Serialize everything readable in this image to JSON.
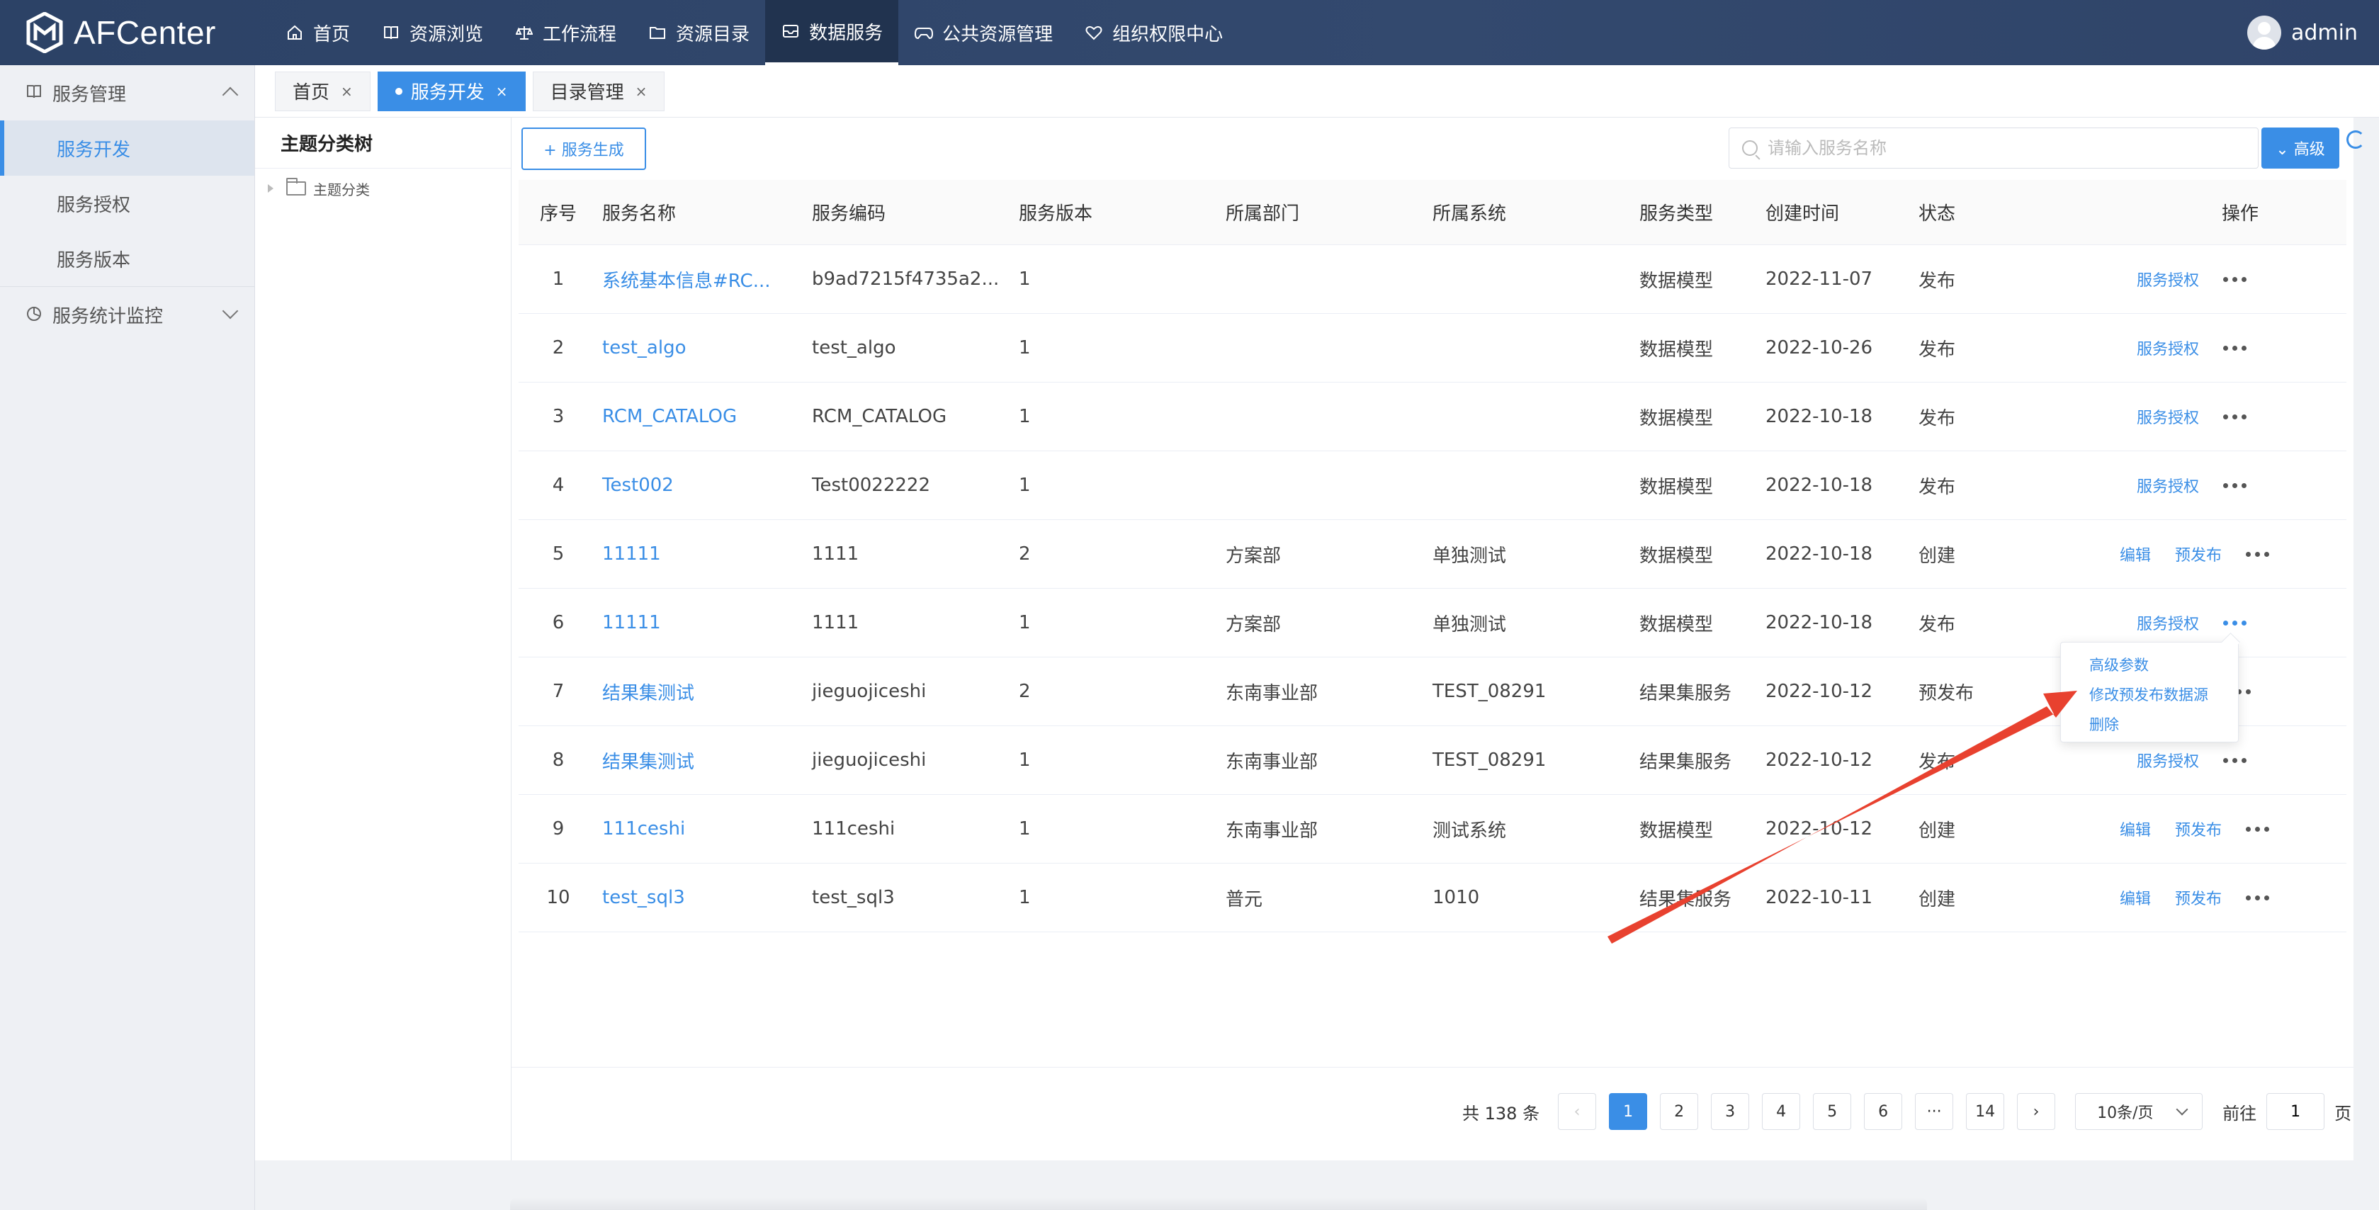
{
  "app": {
    "name": "AFCenter"
  },
  "nav": [
    {
      "label": "首页",
      "icon": "home-icon"
    },
    {
      "label": "资源浏览",
      "icon": "book-icon"
    },
    {
      "label": "工作流程",
      "icon": "scale-icon"
    },
    {
      "label": "资源目录",
      "icon": "folder-icon"
    },
    {
      "label": "数据服务",
      "icon": "inbox-icon",
      "active": true
    },
    {
      "label": "公共资源管理",
      "icon": "gamepad-icon"
    },
    {
      "label": "组织权限中心",
      "icon": "heart-icon"
    }
  ],
  "user": {
    "name": "admin"
  },
  "sidebar": {
    "group1": "服务管理",
    "items": [
      "服务开发",
      "服务授权",
      "服务版本"
    ],
    "group2": "服务统计监控"
  },
  "tabs": [
    {
      "label": "首页",
      "close": "×"
    },
    {
      "label": "服务开发",
      "close": "×"
    },
    {
      "label": "目录管理",
      "close": "×"
    }
  ],
  "tree": {
    "title": "主题分类树",
    "root": "主题分类"
  },
  "toolbar": {
    "gen_label": "+ 服务生成",
    "search_placeholder": "请输入服务名称",
    "adv_label": "⌄ 高级"
  },
  "table": {
    "headers": [
      "序号",
      "服务名称",
      "服务编码",
      "服务版本",
      "所属部门",
      "所属系统",
      "服务类型",
      "创建时间",
      "状态",
      "操作"
    ],
    "rows": [
      {
        "no": "1",
        "name": "系统基本信息#RC...",
        "code": "b9ad7215f4735a2...",
        "ver": "1",
        "dept": "",
        "sys": "",
        "type": "数据模型",
        "time": "2022-11-07",
        "status": "发布"
      },
      {
        "no": "2",
        "name": "test_algo",
        "code": "test_algo",
        "ver": "1",
        "dept": "",
        "sys": "",
        "type": "数据模型",
        "time": "2022-10-26",
        "status": "发布"
      },
      {
        "no": "3",
        "name": "RCM_CATALOG",
        "code": "RCM_CATALOG",
        "ver": "1",
        "dept": "",
        "sys": "",
        "type": "数据模型",
        "time": "2022-10-18",
        "status": "发布"
      },
      {
        "no": "4",
        "name": "Test002",
        "code": "Test0022222",
        "ver": "1",
        "dept": "",
        "sys": "",
        "type": "数据模型",
        "time": "2022-10-18",
        "status": "发布"
      },
      {
        "no": "5",
        "name": "11111",
        "code": "1111",
        "ver": "2",
        "dept": "方案部",
        "sys": "单独测试",
        "type": "数据模型",
        "time": "2022-10-18",
        "status": "创建"
      },
      {
        "no": "6",
        "name": "11111",
        "code": "1111",
        "ver": "1",
        "dept": "方案部",
        "sys": "单独测试",
        "type": "数据模型",
        "time": "2022-10-18",
        "status": "发布"
      },
      {
        "no": "7",
        "name": "结果集测试",
        "code": "jieguojiceshi",
        "ver": "2",
        "dept": "东南事业部",
        "sys": "TEST_08291",
        "type": "结果集服务",
        "time": "2022-10-12",
        "status": "预发布"
      },
      {
        "no": "8",
        "name": "结果集测试",
        "code": "jieguojiceshi",
        "ver": "1",
        "dept": "东南事业部",
        "sys": "TEST_08291",
        "type": "结果集服务",
        "time": "2022-10-12",
        "status": "发布"
      },
      {
        "no": "9",
        "name": "111ceshi",
        "code": "111ceshi",
        "ver": "1",
        "dept": "东南事业部",
        "sys": "测试系统",
        "type": "数据模型",
        "time": "2022-10-12",
        "status": "创建"
      },
      {
        "no": "10",
        "name": "test_sql3",
        "code": "test_sql3",
        "ver": "1",
        "dept": "普元",
        "sys": "1010",
        "type": "结果集服务",
        "time": "2022-10-11",
        "status": "创建"
      }
    ],
    "ops": {
      "auth": "服务授权",
      "edit": "编辑",
      "prepub": "预发布",
      "partial": "权"
    }
  },
  "dropdown": [
    "高级参数",
    "修改预发布数据源",
    "删除"
  ],
  "pagination": {
    "total": "共 138 条",
    "prev": "‹",
    "pages": [
      "1",
      "2",
      "3",
      "4",
      "5",
      "6",
      "···",
      "14"
    ],
    "next": "›",
    "page_size": "10条/页",
    "goto_label": "前往",
    "goto_value": "1",
    "page_suffix": "页"
  },
  "colors": {
    "primary": "#3a8ee6",
    "nav_bg": "#2c4266",
    "arrow": "#e8412f"
  }
}
